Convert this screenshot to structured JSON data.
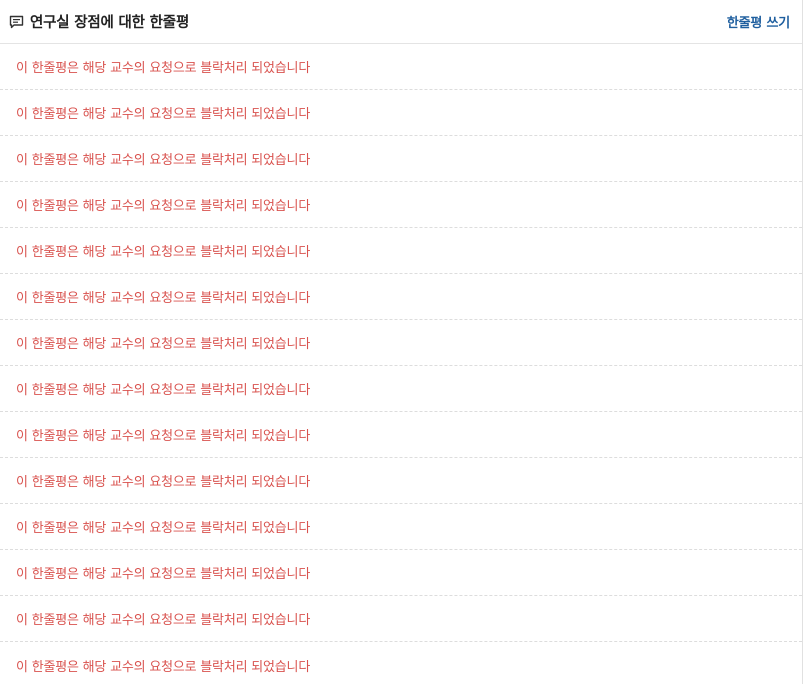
{
  "header": {
    "icon": "comment-lines-icon",
    "title": "연구실 장점에 대한 한줄평",
    "write_label": "한줄평 쓰기"
  },
  "colors": {
    "blocked_text": "#d9534f",
    "link": "#1f5f9f",
    "title": "#222222"
  },
  "reviews": [
    {
      "text": "이 한줄평은 해당 교수의 요청으로 블락처리 되었습니다"
    },
    {
      "text": "이 한줄평은 해당 교수의 요청으로 블락처리 되었습니다"
    },
    {
      "text": "이 한줄평은 해당 교수의 요청으로 블락처리 되었습니다"
    },
    {
      "text": "이 한줄평은 해당 교수의 요청으로 블락처리 되었습니다"
    },
    {
      "text": "이 한줄평은 해당 교수의 요청으로 블락처리 되었습니다"
    },
    {
      "text": "이 한줄평은 해당 교수의 요청으로 블락처리 되었습니다"
    },
    {
      "text": "이 한줄평은 해당 교수의 요청으로 블락처리 되었습니다"
    },
    {
      "text": "이 한줄평은 해당 교수의 요청으로 블락처리 되었습니다"
    },
    {
      "text": "이 한줄평은 해당 교수의 요청으로 블락처리 되었습니다"
    },
    {
      "text": "이 한줄평은 해당 교수의 요청으로 블락처리 되었습니다"
    },
    {
      "text": "이 한줄평은 해당 교수의 요청으로 블락처리 되었습니다"
    },
    {
      "text": "이 한줄평은 해당 교수의 요청으로 블락처리 되었습니다"
    },
    {
      "text": "이 한줄평은 해당 교수의 요청으로 블락처리 되었습니다"
    },
    {
      "text": "이 한줄평은 해당 교수의 요청으로 블락처리 되었습니다"
    }
  ]
}
